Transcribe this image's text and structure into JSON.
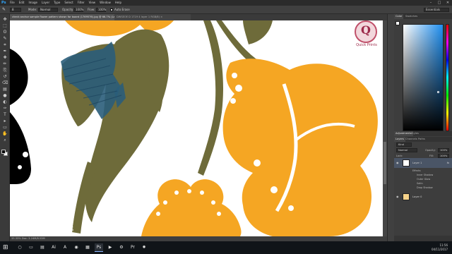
{
  "app": {
    "logo": "Ps",
    "menu": [
      "File",
      "Edit",
      "Image",
      "Layer",
      "Type",
      "Select",
      "Filter",
      "View",
      "Window",
      "Help"
    ],
    "window_buttons": [
      "–",
      "□",
      "✕"
    ]
  },
  "options_bar": {
    "size": "8",
    "mode_label": "Mode:",
    "mode_value": "Normal",
    "opacity_label": "Opacity:",
    "opacity_value": "100%",
    "flow_label": "Flow:",
    "flow_value": "100%",
    "auto_erase_label": "Auto Erase",
    "workspace": "Essentials"
  },
  "document_tabs": [
    "check anchor sample flower pattern shown for board (1769576).jpg @ 66.7% (Layer 1, RGB/8) ×",
    "DWSEOE D 1719 4 layer 1 RGB/8) ×"
  ],
  "toolbar": {
    "tools": [
      "move-tool",
      "marquee-tool",
      "lasso-tool",
      "quick-select-tool",
      "crop-tool",
      "eyedropper-tool",
      "healing-tool",
      "brush-tool",
      "clone-tool",
      "history-brush-tool",
      "eraser-tool",
      "gradient-tool",
      "blur-tool",
      "dodge-tool",
      "pen-tool",
      "type-tool",
      "path-select-tool",
      "shape-tool",
      "hand-tool",
      "zoom-tool"
    ],
    "glyphs": [
      "✥",
      "⬚",
      "ʘ",
      "✎",
      "⌗",
      "✒",
      "✚",
      "✏",
      "⎘",
      "↺",
      "⌫",
      "▤",
      "●",
      "◐",
      "✑",
      "T",
      "▸",
      "▭",
      "✋",
      "⌕"
    ]
  },
  "watermark": {
    "monogram": "Q",
    "text": "Quick Prints"
  },
  "corner_watermark": "Quick Prints",
  "status": "33.33%   Doc: 3.24M/8.53M",
  "panels": {
    "color_tabs": [
      "Color",
      "Swatches"
    ],
    "adjust_tabs": [
      "Adjustments",
      "Styles"
    ],
    "layer_tabs": [
      "Layers",
      "Channels",
      "Paths"
    ],
    "kind_label": "Kind",
    "blend_mode": "Normal",
    "opacity_label": "Opacity:",
    "opacity_value": "100%",
    "lock_label": "Lock:",
    "fill_label": "Fill:",
    "fill_value": "100%"
  },
  "layers": [
    {
      "name": "Layer 1",
      "fx": "fx",
      "effects_header": "Effects",
      "effects": [
        "Inner Shadow",
        "Outer Glow",
        "Satin",
        "Drop Shadow"
      ]
    },
    {
      "name": "Layer 0"
    }
  ],
  "taskbar": {
    "icons": [
      "search",
      "task-view",
      "file-explorer",
      "illustrator",
      "acrobat",
      "chrome",
      "explorer-2",
      "photoshop",
      "media",
      "settings",
      "premiere",
      "firefox"
    ],
    "glyphs": [
      "○",
      "▭",
      "▤",
      "Ai",
      "A",
      "◉",
      "▦",
      "Ps",
      "▶",
      "⚙",
      "Pr",
      "✹"
    ],
    "clock_time": "11:56",
    "clock_date": "04/11/2017"
  },
  "colors": {
    "orange": "#f5a623",
    "olive": "#6e6b3a",
    "blue": "#2a5d7a",
    "black": "#000000"
  }
}
